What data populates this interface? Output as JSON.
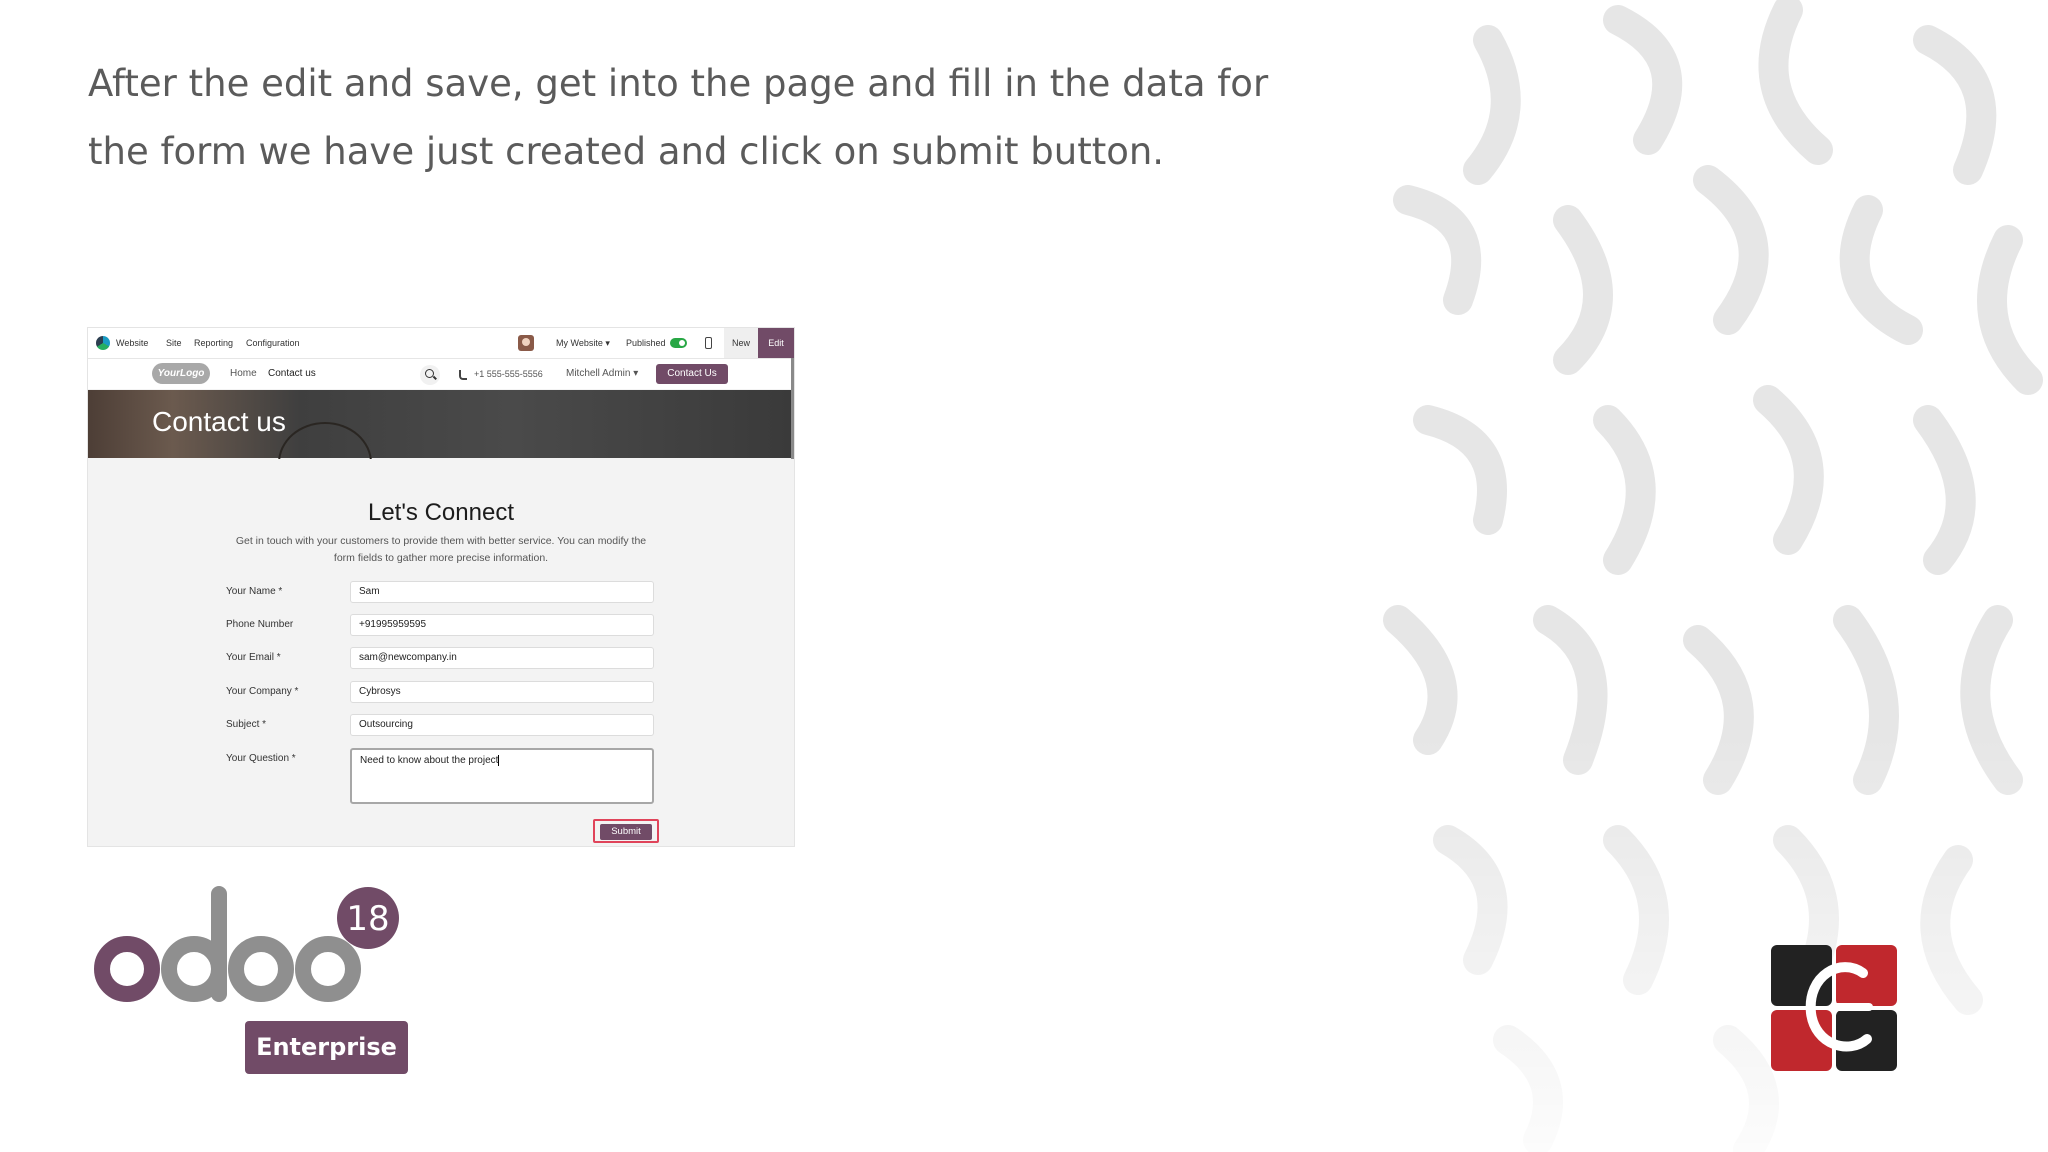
{
  "slide": {
    "instruction": "After the edit and save, get into the page and fill in the data for the form we have just created and click on submit button."
  },
  "topbar": {
    "app_name": "Website",
    "menus": [
      "Site",
      "Reporting",
      "Configuration"
    ],
    "website_selector": "My Website ▾",
    "published_label": "Published",
    "new_label": "New",
    "edit_label": "Edit"
  },
  "site_nav": {
    "logo_text": "YourLogo",
    "links": [
      "Home",
      "Contact us"
    ],
    "phone": "+1 555-555-5556",
    "user": "Mitchell Admin ▾",
    "cta": "Contact Us"
  },
  "banner": {
    "title": "Contact us"
  },
  "form": {
    "title": "Let's Connect",
    "description": "Get in touch with your customers to provide them with better service. You can modify the form fields to gather more precise information.",
    "fields": [
      {
        "label": "Your Name *",
        "value": "Sam"
      },
      {
        "label": "Phone Number",
        "value": "+91995959595"
      },
      {
        "label": "Your Email *",
        "value": "sam@newcompany.in"
      },
      {
        "label": "Your Company *",
        "value": "Cybrosys"
      },
      {
        "label": "Subject *",
        "value": "Outsourcing"
      },
      {
        "label": "Your Question *",
        "value": "Need to know about the project"
      }
    ],
    "submit_label": "Submit"
  },
  "branding": {
    "version": "18",
    "edition": "Enterprise",
    "accent_color": "#714b67"
  }
}
